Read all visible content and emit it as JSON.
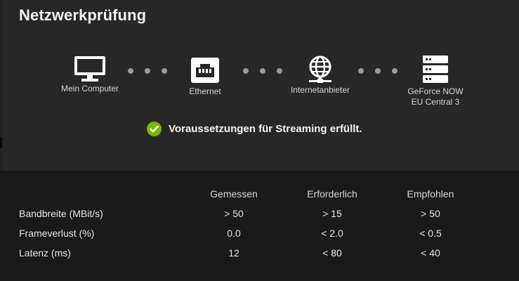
{
  "title": "Netzwerkprüfung",
  "path_nodes": [
    {
      "label": "Mein Computer",
      "icon": "monitor-icon"
    },
    {
      "label": "Ethernet",
      "icon": "ethernet-port-icon"
    },
    {
      "label": "Internetanbieter",
      "icon": "globe-network-icon"
    },
    {
      "label": "GeForce NOW\nEU Central 3",
      "icon": "server-stack-icon"
    }
  ],
  "status": {
    "text": "Voraussetzungen für Streaming erfüllt.",
    "icon": "check-circle-icon",
    "color": "#76b900"
  },
  "table": {
    "headers": [
      "",
      "Gemessen",
      "Erforderlich",
      "Empfohlen"
    ],
    "rows": [
      [
        "Bandbreite (MBit/s)",
        "> 50",
        "> 15",
        "> 50"
      ],
      [
        "Frameverlust (%)",
        "0.0",
        "< 2.0",
        "< 0.5"
      ],
      [
        "Latenz (ms)",
        "12",
        "< 80",
        "< 40"
      ]
    ]
  },
  "colors": {
    "panel": "#272727",
    "background": "#1a1a1a",
    "accent": "#76b900"
  }
}
